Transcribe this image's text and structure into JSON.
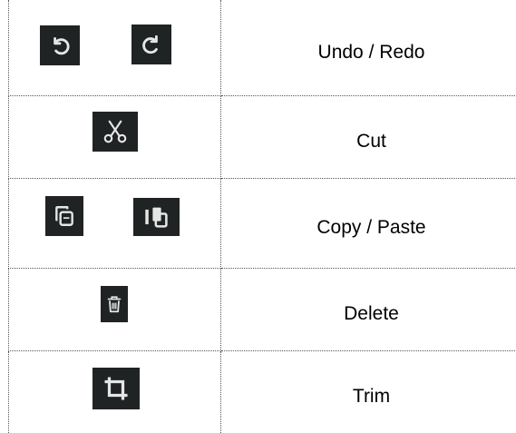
{
  "rows": [
    {
      "label": "Undo / Redo",
      "icons": [
        "undo-icon",
        "redo-icon"
      ]
    },
    {
      "label": "Cut",
      "icons": [
        "scissors-icon"
      ]
    },
    {
      "label": "Copy / Paste",
      "icons": [
        "copy-icon",
        "paste-icon"
      ]
    },
    {
      "label": "Delete",
      "icons": [
        "trash-icon"
      ]
    },
    {
      "label": "Trim",
      "icons": [
        "crop-icon"
      ]
    }
  ],
  "colors": {
    "icon_background": "#1f2323",
    "icon_foreground": "#e6e6e6"
  }
}
